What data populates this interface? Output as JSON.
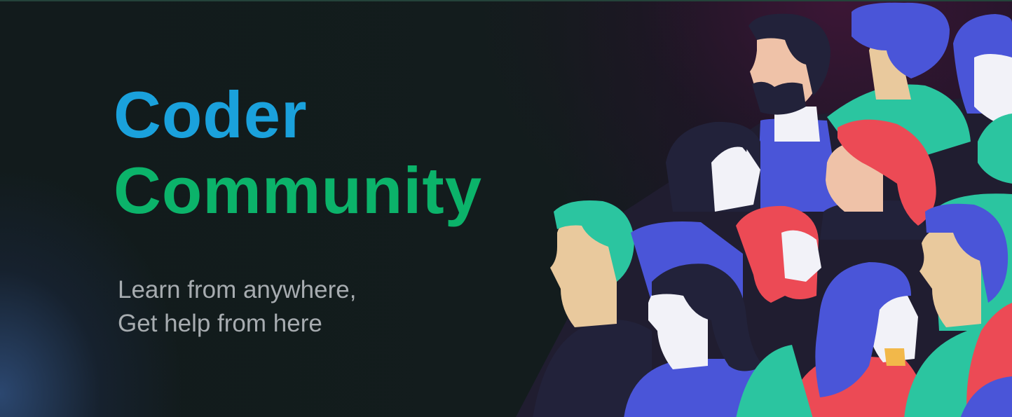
{
  "hero": {
    "title_line1": "Coder",
    "title_line2": "Community",
    "tagline_line1": "Learn from anywhere,",
    "tagline_line2": "Get help from here"
  },
  "colors": {
    "accent_blue": "#1aa1dc",
    "accent_green": "#0bb36a",
    "text_muted": "#a7acb0",
    "illustration_blue": "#4a55d8",
    "illustration_teal": "#2bc5a0",
    "illustration_red": "#ec4a55",
    "illustration_navy": "#22223a",
    "illustration_skin": "#e9c99d"
  },
  "illustration": {
    "icon": "crowd-of-people-illustration"
  }
}
